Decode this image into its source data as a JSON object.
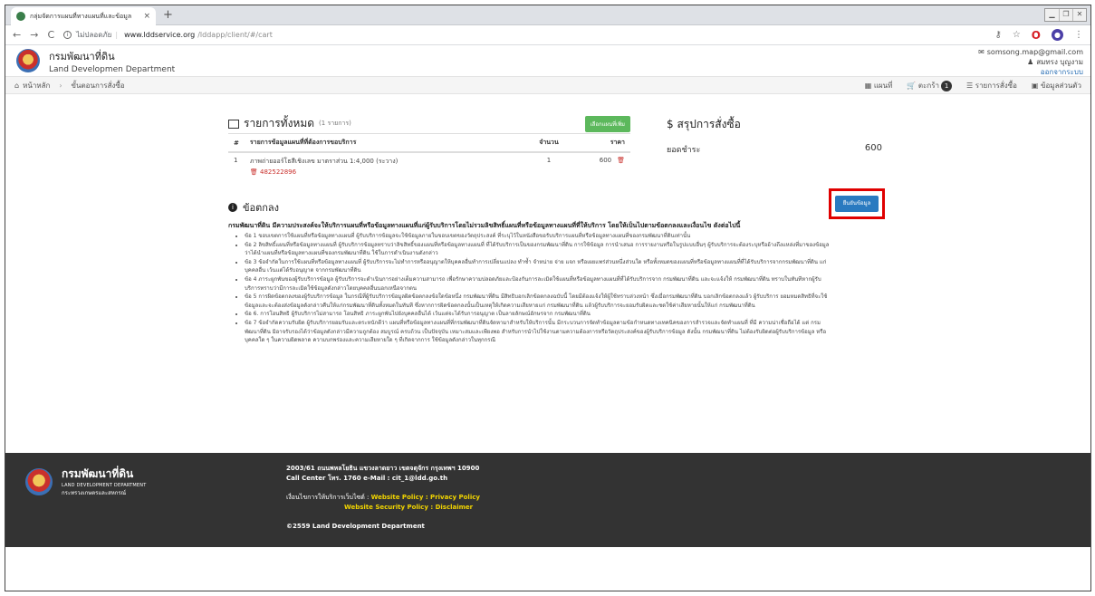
{
  "browser": {
    "tab_title": "กลุ่มจัดการแผนที่ทางแผนที่และข้อมูล",
    "tab_close": "×",
    "new_tab": "+",
    "url_info": "ไม่ปลอดภัย",
    "url_domain": "www.lddservice.org",
    "url_path": "/lddapp/client/#/cart"
  },
  "header": {
    "brand_th": "กรมพัฒนาที่ดิน",
    "brand_en": "Land Developmen Department",
    "user_email": "somsong.map@gmail.com",
    "user_name": "สมทรง บุญงาม",
    "logout": "ออกจากระบบ"
  },
  "nav": {
    "home": "หน้าหลัก",
    "step": "ขั้นตอนการสั่งซื้อ",
    "map": "แผนที่",
    "cart": "ตะกร้า",
    "cart_count": "1",
    "orders": "รายการสั่งซื้อ",
    "profile": "ข้อมูลส่วนตัว"
  },
  "cart": {
    "title": "รายการทั้งหมด",
    "count_label": "(1 รายการ)",
    "add_button": "เลือกแผนที่เพิ่ม",
    "columns": [
      "#",
      "รายการข้อมูลแผนที่ที่ต้องการขอบริการ",
      "จำนวน",
      "ราคา"
    ],
    "items": [
      {
        "num": "1",
        "name": "ภาพถ่ายออร์โธสีเชิงเลข มาตราส่วน 1:4,000 (ระวาง)",
        "sub_id": "482522896",
        "qty": "1",
        "price": "600"
      }
    ]
  },
  "summary": {
    "title": "สรุปการสั่งซื้อ",
    "total_label": "ยอดชำระ",
    "total_value": "600"
  },
  "confirm_button": "ยืนยันข้อมูล",
  "terms": {
    "title": "ข้อตกลง",
    "intro": "กรมพัฒนาที่ดิน มีความประสงค์จะให้บริการแผนที่หรือข้อมูลทางแผนที่แก่ผู้รับบริการโดยไม่รวมลิขสิทธิ์แผนที่หรือข้อมูลทางแผนที่ที่ให้บริการ โดยให้เป็นไปตามข้อตกลงและเงื่อนไข ดังต่อไปนี้",
    "items": [
      "ข้อ 1 ขอบเขตการใช้แผนที่หรือข้อมูลทางแผนที่ ผู้รับบริการข้อมูลจะใช้ข้อมูลภายในขอบเขตของวัตถุประสงค์ ที่ระบุไว้ในหนังสือขอรับบริการแผนที่หรือข้อมูลทางแผนที่ของกรมพัฒนาที่ดินเท่านั้น",
      "ข้อ 2 ลิขสิทธิ์แผนที่หรือข้อมูลทางแผนที่ ผู้รับบริการข้อมูลทราบว่าลิขสิทธิ์ของแผนที่หรือข้อมูลทางแผนที่ ที่ได้รับบริการเป็นของกรมพัฒนาที่ดิน การใช้ข้อมูล การนำเสนอ การรายงานหรือในรูปแบบอื่นๆ ผู้รับบริการจะต้องระบุหรืออ้างถึงแหล่งที่มาของข้อมูลว่าได้นำแผนที่หรือข้อมูลทางแผนที่ของกรมพัฒนาที่ดิน ใช้ในการดำเนินงานดังกล่าว",
      "ข้อ 3 ข้อจำกัดในการใช้แผนที่หรือข้อมูลทางแผนที่ ผู้รับบริการจะไม่ทำการหรืออนุญาตให้บุคคลอื่นทำการเปลี่ยนแปลง ทำซ้ำ จำหน่าย จ่าย แจก หรือเผยแพร่ส่วนหนึ่งส่วนใด หรือทั้งหมดของแผนที่หรือข้อมูลทางแผนที่ที่ได้รับบริการจากกรมพัฒนาที่ดิน แก่บุคคลอื่น เว้นแต่ได้รับอนุญาต จากกรมพัฒนาที่ดิน",
      "ข้อ 4 ภาระผูกพันของผู้รับบริการข้อมูล ผู้รับบริการจะดำเนินการอย่างเต็มความสามารถ เพื่อรักษาความปลอดภัยและป้องกันการละเมิดใช้แผนที่หรือข้อมูลทางแผนที่ที่ได้รับบริการจาก กรมพัฒนาที่ดิน และจะแจ้งให้ กรมพัฒนาที่ดิน ทราบในทันทีหากผู้รับบริการทราบว่ามีการละเมิดใช้ข้อมูลดังกล่าวโดยบุคคลอื่นนอกเหนือจากตน",
      "ข้อ 5 การผิดข้อตกลงของผู้รับบริการข้อมูล ในกรณีที่ผู้รับบริการข้อมูลผิดข้อตกลงข้อใดข้อหนึ่ง กรมพัฒนาที่ดิน มีสิทธิบอกเลิกข้อตกลงฉบับนี้ โดยมีต้องแจ้งให้ผู้ใช้ทราบล่วงหน้า ซึ่งเมื่อกรมพัฒนาที่ดิน บอกเลิกข้อตกลงแล้ว ผู้รับบริการ ยอมหมดสิทธิที่จะใช้ข้อมูลและจะต้องส่งข้อมูลดังกล่าวคืนให้แก่กรมพัฒนาที่ดินทั้งหมดในทันที ซึ่งหากการผิดข้อตกลงนั้นเป็นเหตุให้เกิดความเสียหายแก่ กรมพัฒนาที่ดิน แล้วผู้รับบริการจะยอมรับผิดและชดใช้ค่าเสียหายนั้นให้แก่ กรมพัฒนาที่ดิน",
      "ข้อ 6. การโอนสิทธิ ผู้รับบริการไม่สามารถ โอนสิทธิ ภาระผูกพันไปยังบุคคลอื่นได้ เว้นแต่จะได้รับการอนุญาต เป็นลายลักษณ์อักษรจาก กรมพัฒนาที่ดิน",
      "ข้อ 7 ข้อจำกัดความรับผิด ผู้รับบริการยอมรับและตระหนักดีว่า แผนที่หรือข้อมูลทางแผนที่ที่กรมพัฒนาที่ดินจัดหามาสำหรับให้บริการนั้น มีกระบวนการจัดทำข้อมูลตามข้อกำหนดทางเทคนิคของการสำรวจและจัดทำแผนที่ ที่มี ความน่าเชื่อถือได้ แต่ กรมพัฒนาที่ดิน มิอาจรับรองได้ว่าข้อมูลดังกล่าวมีความถูกต้อง สมบูรณ์ ครบถ้วน เป็นปัจจุบัน เหมาะสมและเพียงพอ สำหรับการนำไปใช้งานตามความต้องการหรือวัตถุประสงค์ของผู้รับบริการข้อมูล ดังนั้น กรมพัฒนาที่ดิน ไม่ต้องรับผิดต่อผู้รับบริการข้อมูล หรือบุคคลใด ๆ ในความผิดพลาด ความบกพร่องและความเสียหายใด ๆ ที่เกิดจากการ ใช้ข้อมูลดังกล่าวในทุกกรณี"
    ]
  },
  "footer": {
    "brand_th": "กรมพัฒนาที่ดิน",
    "brand_en": "LAND DEVELOPMENT DEPARTMENT",
    "brand_sub": "กระทรวงเกษตรและสหกรณ์",
    "address": "2003/61 ถนนพหลโยธิน แขวงลาดยาว เขตจตุจักร กรุงเทพฯ 10900",
    "contact": "Call Center โทร. 1760   e-Mail : cit_1@ldd.go.th",
    "policy_label": "เงื่อนไขการให้บริการเว็บไซต์ :",
    "policy_links": "Website Policy : Privacy Policy",
    "security_links": "Website Security Policy : Disclaimer",
    "copyright": "©2559 Land Development Department"
  },
  "colors": {
    "accent_blue": "#2a7ac0",
    "green_button": "#5cb85c",
    "highlight_red": "#e00000",
    "footer_bg": "#333333",
    "footer_link": "#f1d400"
  }
}
